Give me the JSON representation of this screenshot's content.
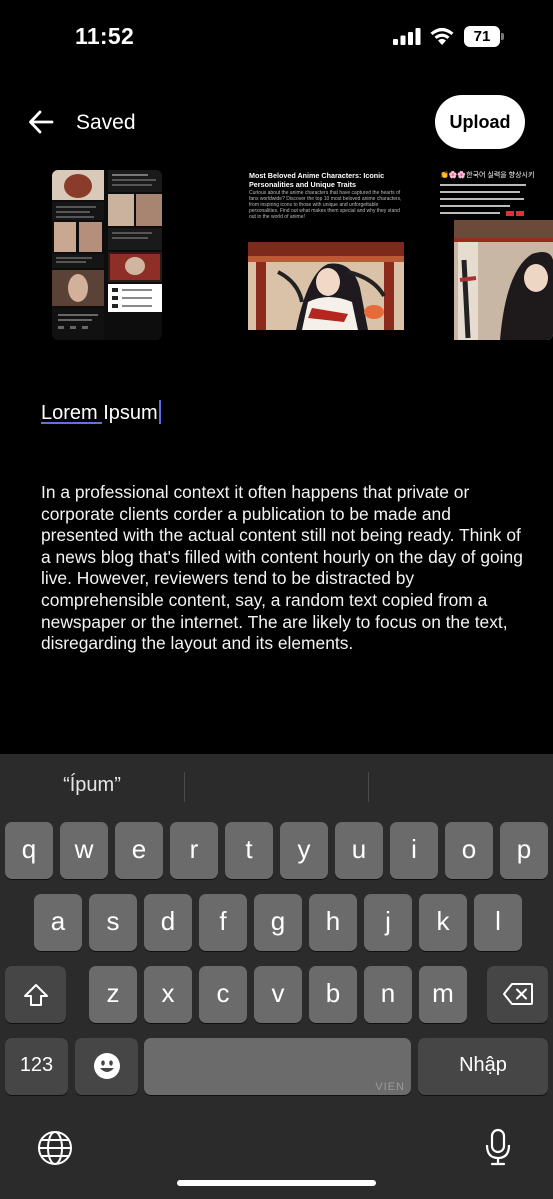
{
  "status_bar": {
    "time": "11:52",
    "battery_level": "71"
  },
  "header": {
    "back_icon": "arrow-left-icon",
    "title": "Saved",
    "upload_label": "Upload"
  },
  "thumbnails": {
    "thumb_2_title": "Most Beloved Anime Characters: Iconic Personalities and Unique Traits",
    "thumb_2_body": "Curious about the anime characters that have captured the hearts of fans worldwide? Discover the top 10 most beloved anime characters, from inspiring icons to those with unique and unforgettable personalities. Find out what makes them special and why they stand out in the world of anime!",
    "thumb_3_text": "👏🌸🌸한국어 실력을 향상시키"
  },
  "editor": {
    "title_value": "Lorem Ipsum",
    "body": "In a professional context it often happens that private or corporate clients corder a publication to be made and presented with the actual content still not being ready. Think of a news blog that's filled with content hourly on the day of going live. However, reviewers tend to be distracted by comprehensible content, say, a random text copied from a newspaper or the internet. The are likely to focus on the text, disregarding the layout and its elements."
  },
  "keyboard": {
    "suggestion_1": "“Ípum”",
    "row1": [
      "q",
      "w",
      "e",
      "r",
      "t",
      "y",
      "u",
      "i",
      "o",
      "p"
    ],
    "row2": [
      "a",
      "s",
      "d",
      "f",
      "g",
      "h",
      "j",
      "k",
      "l"
    ],
    "row3": [
      "z",
      "x",
      "c",
      "v",
      "b",
      "n",
      "m"
    ],
    "numbers_label": "123",
    "space_label": "VIEN",
    "return_label": "Nhập"
  },
  "colors": {
    "background": "#000000",
    "keyboard_bg": "#2b2b2b",
    "key_bg": "#6b6b6b",
    "key_dark_bg": "#464646",
    "caret": "#5b6de6"
  }
}
